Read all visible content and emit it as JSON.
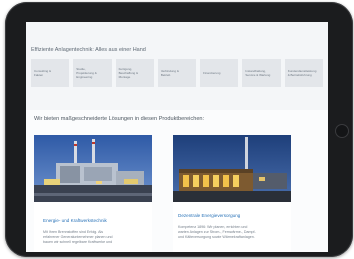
{
  "page": {
    "headline": "Effiziente Anlagentechnik: Alles aus einer Hand",
    "section_title": "Wir bieten maßgeschneiderte Lösungen in diesen Produktbereichen:"
  },
  "nav": {
    "tiles": [
      {
        "line1": "Consulting &",
        "line2": "Fakten",
        "line3": ""
      },
      {
        "line1": "Studie,",
        "line2": "Projektierung &",
        "line3": "Engineering"
      },
      {
        "line1": "Fertigung,",
        "line2": "Beschaffung &",
        "line3": "Montage"
      },
      {
        "line1": "Verbindung &",
        "line2": "Betrieb",
        "line3": ""
      },
      {
        "line1": "Finanzierung",
        "line2": "",
        "line3": ""
      },
      {
        "line1": "Instandhaltung,",
        "line2": "Service & Wartung",
        "line3": ""
      },
      {
        "line1": "Kundendienstleistung",
        "line2": "& Betriebsfuhrung",
        "line3": ""
      }
    ]
  },
  "cards": [
    {
      "title": "Energie- und Kraftwerkstechnik",
      "lines": [
        "Mit Ihren Brennstoffen sind Erfolg. Als",
        "erfahrener Generalunternehmer planen und",
        "bauen wir schnell regelbare Kraftwerke und"
      ]
    },
    {
      "title": "Dezentrale Energieversorgung",
      "lines": [
        "Kompetenz 1896: Wir planen, errichten und",
        "warten Anlagen zur Strom-, Fernwärme-, Dampf-",
        "und Kälteversorgung sowie Wärmekraftanlagen."
      ]
    }
  ],
  "colors": {
    "bezel": "#1b1c1e",
    "accent_link": "#2a73b8",
    "tile_bg": "#e3e6ea"
  }
}
